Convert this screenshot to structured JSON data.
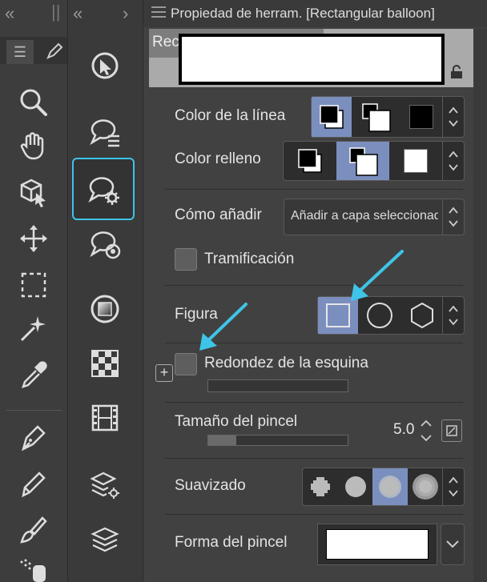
{
  "toolbar": {
    "collapse_label": "«",
    "menu_label": "☰",
    "tools": [
      "zoom-icon",
      "hand-icon",
      "3d-object-icon",
      "move-icon",
      "selection-icon",
      "magic-wand-icon",
      "eyedropper-icon",
      "pen-icon",
      "pencil-icon",
      "brush-icon",
      "airbrush-icon"
    ]
  },
  "subtoolbar": {
    "collapse_label": "«",
    "expand_label": "›",
    "tools": [
      "operation-icon",
      "balloon-list-icon",
      "balloon-settings-icon",
      "balloon-target-icon",
      "gradient-icon",
      "tiles-icon",
      "film-icon",
      "layers-settings-icon",
      "layers-icon"
    ]
  },
  "panel": {
    "title": "Propiedad de herram. [Rectangular balloon]",
    "subtool_name": "Rectangular balloon",
    "line_color": {
      "label": "Color de la línea"
    },
    "fill_color": {
      "label": "Color relleno"
    },
    "add_mode": {
      "label": "Cómo añadir",
      "value": "Añadir a capa seleccionad"
    },
    "tone": {
      "label": "Tramificación"
    },
    "figure": {
      "label": "Figura",
      "options": [
        "square-icon",
        "circle-icon",
        "hexagon-icon"
      ],
      "selected": 0
    },
    "corner": {
      "label": "Redondez de la esquina",
      "add_label": "+"
    },
    "brush_size": {
      "label": "Tamaño del pincel",
      "value": "5.0",
      "level": 0.2
    },
    "smoothing": {
      "label": "Suavizado",
      "selected": 2
    },
    "brush_shape": {
      "label": "Forma del pincel"
    }
  },
  "colors": {
    "accent": "#7b8fbe",
    "highlight_border": "#3ec4e6",
    "arrow": "#3ec4e6"
  }
}
